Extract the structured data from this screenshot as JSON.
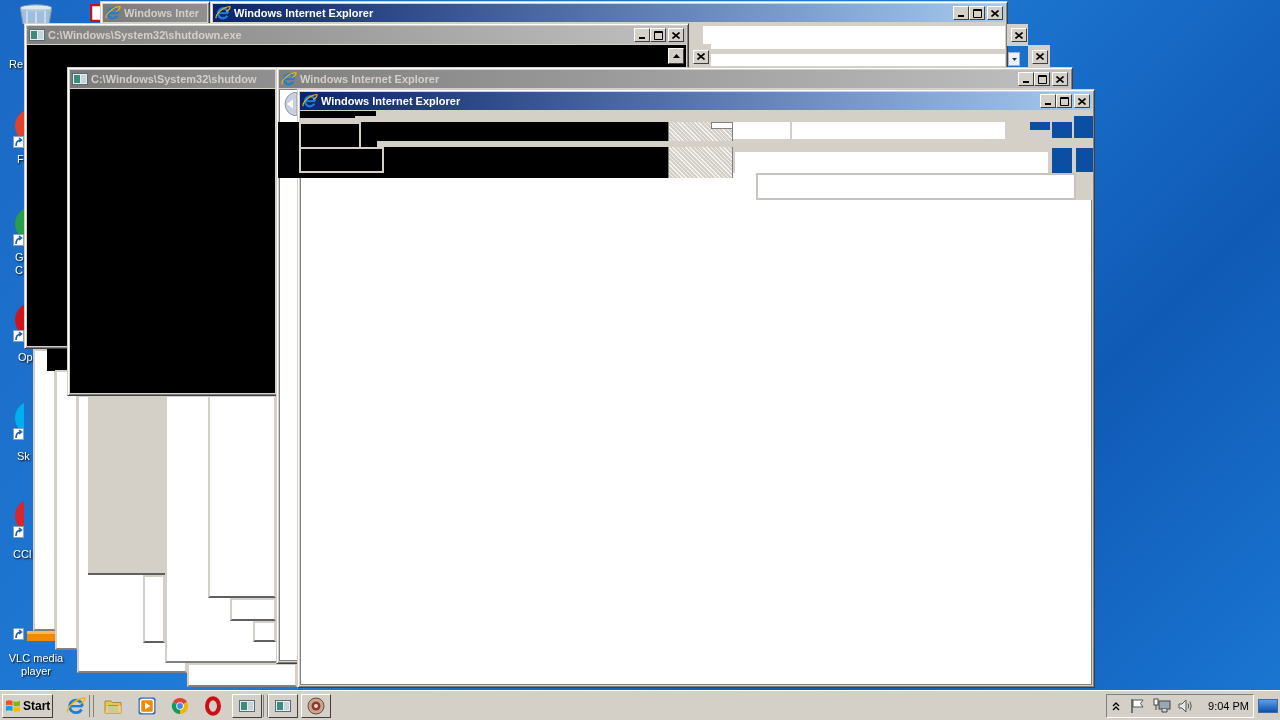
{
  "desktop": {
    "icons": [
      {
        "kind": "recycle-bin",
        "label": "Re"
      },
      {
        "kind": "shortcut",
        "label": "F"
      },
      {
        "kind": "shortcut",
        "label": "G C"
      },
      {
        "kind": "shortcut",
        "label": "Op"
      },
      {
        "kind": "shortcut",
        "label": "Sk"
      },
      {
        "kind": "shortcut",
        "label": "CCl"
      },
      {
        "kind": "shortcut",
        "label": "VLC media player"
      }
    ]
  },
  "windows": [
    {
      "kind": "browser",
      "title": "Windows Inter",
      "active": false
    },
    {
      "kind": "browser",
      "title": "Windows Internet Explorer",
      "active": true,
      "controls": [
        {
          "kind": "minimize"
        },
        {
          "kind": "maximize"
        },
        {
          "kind": "close"
        }
      ]
    },
    {
      "kind": "console",
      "title": "C:\\Windows\\System32\\shutdown.exe",
      "active": false,
      "controls": [
        {
          "kind": "minimize"
        },
        {
          "kind": "maximize"
        },
        {
          "kind": "close"
        }
      ]
    },
    {
      "kind": "console",
      "title": "C:\\Windows\\System32\\shutdow",
      "active": false
    },
    {
      "kind": "browser",
      "title": "Windows Internet Explorer",
      "active": false,
      "controls": [
        {
          "kind": "minimize"
        },
        {
          "kind": "maximize"
        },
        {
          "kind": "close"
        }
      ]
    },
    {
      "kind": "browser",
      "title": "Windows Internet Explorer",
      "active": true,
      "controls": [
        {
          "kind": "minimize"
        },
        {
          "kind": "maximize"
        },
        {
          "kind": "close"
        }
      ]
    }
  ],
  "taskbar": {
    "start_button": "Start",
    "clock": "9:04 PM"
  }
}
